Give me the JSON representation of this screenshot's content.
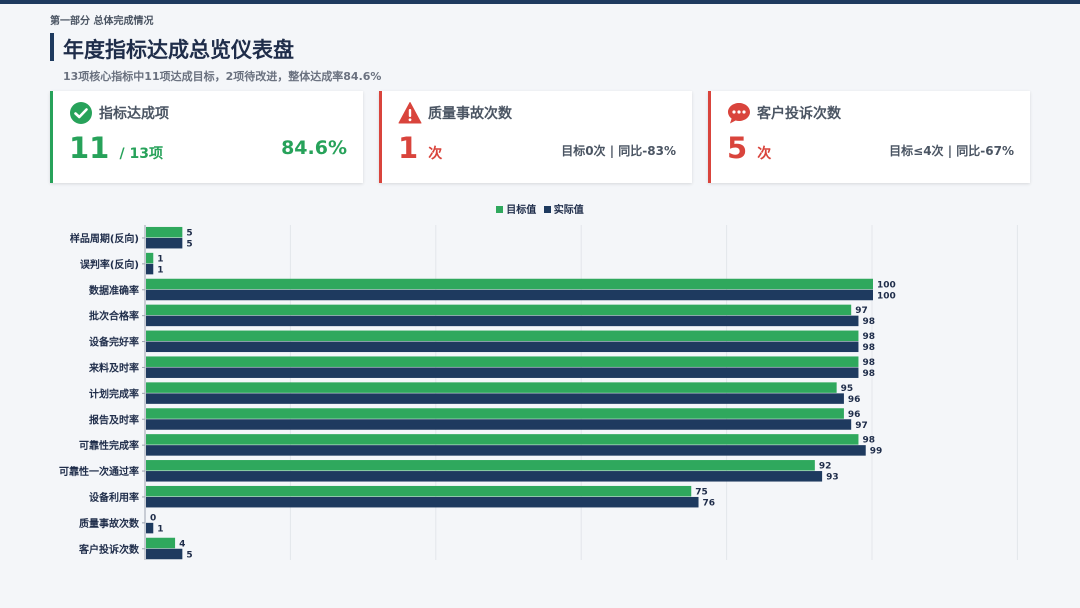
{
  "header": {
    "section": "第一部分 总体完成情况",
    "title": "年度指标达成总览仪表盘",
    "subtitle": "13项核心指标中11项达成目标，2项待改进，整体达成率84.6%"
  },
  "cards": [
    {
      "label": "指标达成项",
      "value": "11",
      "unit": "/ 13项",
      "right": "84.6%",
      "icon": "check-circle-icon",
      "color": "#27a25a"
    },
    {
      "label": "质量事故次数",
      "value": "1",
      "unit": "次",
      "right": "目标0次 | 同比-83%",
      "icon": "warning-triangle-icon",
      "color": "#d9443c"
    },
    {
      "label": "客户投诉次数",
      "value": "5",
      "unit": "次",
      "right": "目标≤4次 | 同比-67%",
      "icon": "chat-bubble-icon",
      "color": "#d9443c"
    }
  ],
  "legend": {
    "target": "目标值",
    "actual": "实际值"
  },
  "colors": {
    "target": "#2fa85d",
    "actual": "#1e3a5f"
  },
  "chart_data": {
    "type": "bar",
    "orientation": "horizontal",
    "categories": [
      "样品周期(反向)",
      "误判率(反向)",
      "数据准确率",
      "批次合格率",
      "设备完好率",
      "来料及时率",
      "计划完成率",
      "报告及时率",
      "可靠性完成率",
      "可靠性一次通过率",
      "设备利用率",
      "质量事故次数",
      "客户投诉次数"
    ],
    "series": [
      {
        "name": "目标值",
        "values": [
          5,
          1,
          100,
          97,
          98,
          98,
          95,
          96,
          98,
          92,
          75,
          0,
          4
        ]
      },
      {
        "name": "实际值",
        "values": [
          5,
          1,
          100,
          98,
          98,
          98,
          96,
          97,
          99,
          93,
          76,
          1,
          5
        ]
      }
    ],
    "xlim": [
      0,
      120
    ],
    "grid": true,
    "legend_position": "top-center"
  }
}
